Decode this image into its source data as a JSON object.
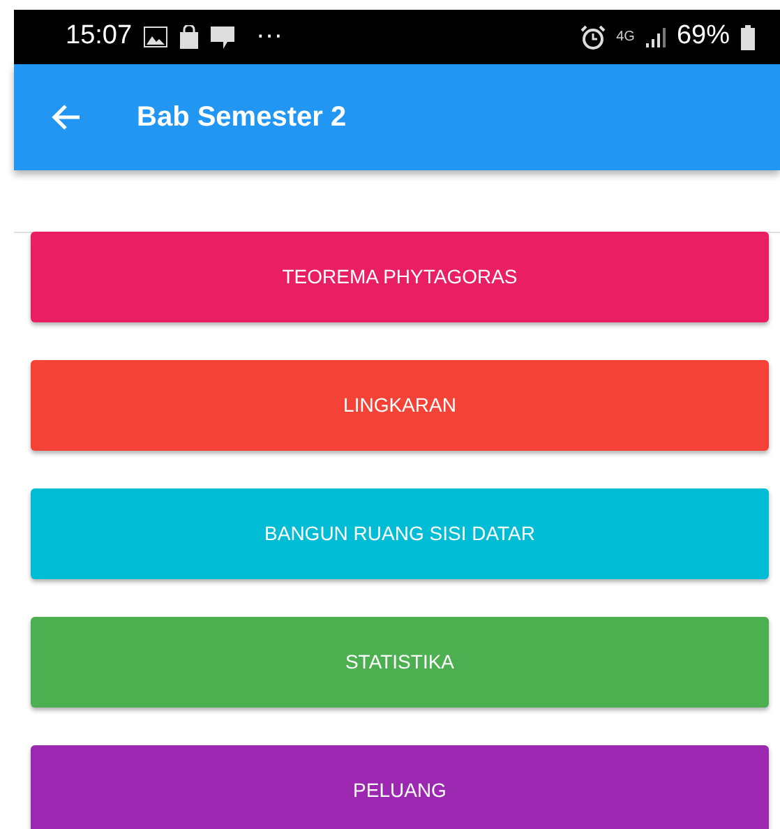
{
  "status_bar": {
    "time": "15:07",
    "more": "···",
    "network": "4G",
    "battery": "69%"
  },
  "app_bar": {
    "title": "Bab Semester 2"
  },
  "chapters": [
    {
      "label": "TEOREMA PHYTAGORAS",
      "color": "#e91e63"
    },
    {
      "label": "LINGKARAN",
      "color": "#f44336"
    },
    {
      "label": "BANGUN RUANG SISI DATAR",
      "color": "#00bcd4"
    },
    {
      "label": "STATISTIKA",
      "color": "#4caf50"
    },
    {
      "label": "PELUANG",
      "color": "#9c27b0"
    }
  ]
}
